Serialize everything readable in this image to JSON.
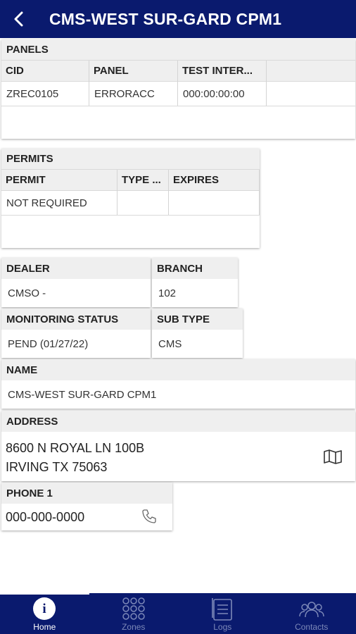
{
  "header": {
    "title": "CMS-WEST SUR-GARD CPM1"
  },
  "panels": {
    "title": "PANELS",
    "columns": [
      "CID",
      "PANEL",
      "TEST INTER..."
    ],
    "row": [
      "ZREC0105",
      "ERRORACC",
      "000:00:00:00"
    ]
  },
  "permits": {
    "title": "PERMITS",
    "columns": [
      "PERMIT",
      "TYPE ...",
      "EXPIRES"
    ],
    "row": [
      "NOT REQUIRED",
      "",
      ""
    ]
  },
  "dealer": {
    "label": "DEALER",
    "value": "CMSO -"
  },
  "branch": {
    "label": "BRANCH",
    "value": "102"
  },
  "monitoring": {
    "label": "MONITORING STATUS",
    "value": "PEND (01/27/22)"
  },
  "subtype": {
    "label": "SUB TYPE",
    "value": "CMS"
  },
  "name": {
    "label": "NAME",
    "value": "CMS-WEST SUR-GARD CPM1"
  },
  "address": {
    "label": "ADDRESS",
    "line1": "8600 N ROYAL LN 100B",
    "line2": "IRVING TX 75063"
  },
  "phone": {
    "label": "PHONE 1",
    "value": "000-000-0000"
  },
  "nav": {
    "home": "Home",
    "zones": "Zones",
    "logs": "Logs",
    "contacts": "Contacts"
  },
  "colors": {
    "brand": "#0a1a6e",
    "section_bg": "#efefef"
  }
}
